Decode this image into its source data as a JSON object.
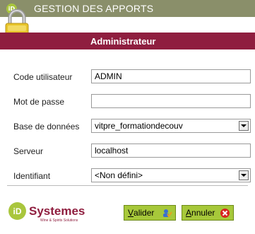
{
  "window": {
    "title": "GESTION DES APPORTS",
    "logo_text": "iD"
  },
  "banner": {
    "title": "Administrateur"
  },
  "form": {
    "code_utilisateur": {
      "label": "Code utilisateur",
      "value": "ADMIN"
    },
    "mot_de_passe": {
      "label": "Mot de passe",
      "value": ""
    },
    "base_de_donnees": {
      "label": "Base de données",
      "value": "vitpre_formationdecouv"
    },
    "serveur": {
      "label": "Serveur",
      "value": "localhost"
    },
    "identifiant": {
      "label": "Identifiant",
      "value": "<Non défini>"
    }
  },
  "brand": {
    "logo_text": "iD",
    "name": "Systemes",
    "tagline": "Wine & Spirits Solutions"
  },
  "buttons": {
    "valider": {
      "underline": "V",
      "rest": "alider"
    },
    "annuler": {
      "underline": "A",
      "rest": "nnuler"
    }
  },
  "colors": {
    "accent": "#8f1e3f",
    "titlebar": "#8a8f6a",
    "button": "#a7c83a",
    "brand_green": "#a9c63d"
  }
}
